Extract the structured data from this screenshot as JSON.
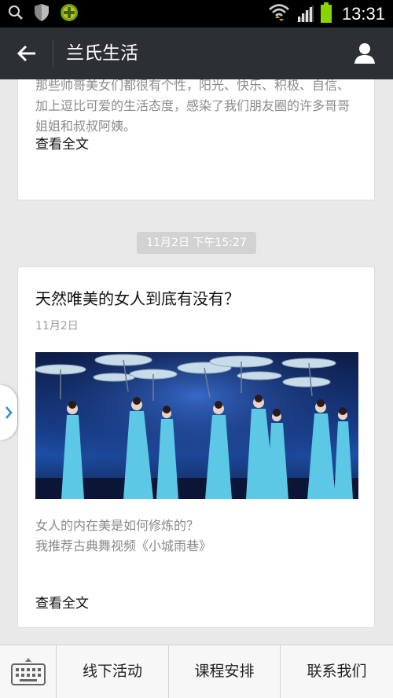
{
  "status_bar": {
    "time": "13:31",
    "icons": [
      "search-icon",
      "shield-icon",
      "plus-badge-icon",
      "wifi-icon",
      "signal-icon",
      "battery-icon"
    ]
  },
  "header": {
    "title": "兰氏生活",
    "back_icon": "arrow-left-icon",
    "profile_icon": "person-icon"
  },
  "feed": {
    "card1": {
      "summary": "那些帅哥美女们都很有个性，阳光、快乐、积极、自信、加上逗比可爱的生活态度，感染了我们朋友圈的许多哥哥姐姐和叔叔阿姨。",
      "read_more": "查看全文"
    },
    "timestamp": "11月2日 下午15:27",
    "card2": {
      "title": "天然唯美的女人到底有没有？",
      "date": "11月2日",
      "summary_line1": "女人的内在美是如何修炼的？",
      "summary_line2": "我推荐古典舞视频《小城雨巷》",
      "read_more": "查看全文"
    }
  },
  "bottom_menu": {
    "keyboard_icon": "keyboard-icon",
    "items": [
      {
        "label": "线下活动"
      },
      {
        "label": "课程安排"
      },
      {
        "label": "联系我们"
      }
    ]
  },
  "colors": {
    "status_bar": "#000000",
    "title_bar": "#2c3034",
    "page_bg": "#e9e9e9",
    "battery": "#8ad300",
    "wifi_accent": "#f0a400"
  }
}
